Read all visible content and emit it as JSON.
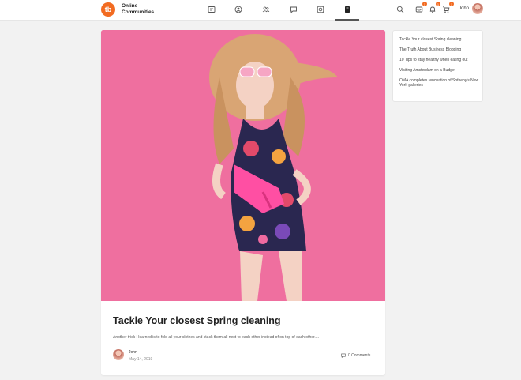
{
  "header": {
    "logo_text": "tb",
    "brand_line1": "Online",
    "brand_line2": "Communities",
    "user_name": "John",
    "badges": {
      "messages": "1",
      "notifications": "1",
      "cart": "1"
    }
  },
  "post": {
    "title": "Tackle Your closest Spring cleaning",
    "excerpt": "Another trick I learned is to fold all your clothes and stack them all next to each other instead of on top of each other....",
    "author": "John",
    "date": "May 14, 2019",
    "comments": "0 Comments"
  },
  "sidebar": {
    "links": [
      "Tackle Your closest Spring cleaning",
      "The Truth About Business Blogging",
      "10 Tips to stay healthy when eating out",
      "Visiting Amsterdam on a Budget",
      "OMA completes renovation of Sotheby's New York galleries"
    ]
  },
  "colors": {
    "accent": "#f26b21",
    "image_bg": "#ef6f9f"
  }
}
